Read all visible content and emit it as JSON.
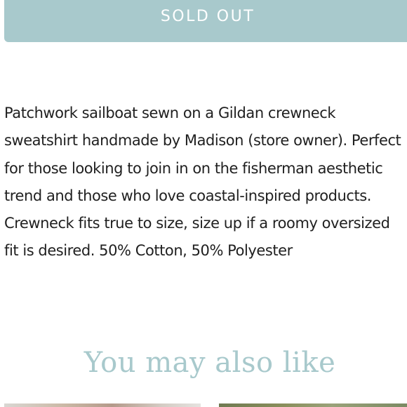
{
  "product": {
    "sold_out_label": "SOLD OUT",
    "description": "Patchwork sailboat sewn on a Gildan crewneck sweatshirt handmade by Madison (store owner). Perfect for those looking to join in on the fisherman aesthetic trend and those who love coastal-inspired products. Crewneck fits true to size, size up if a roomy oversized fit is desired. 50% Cotton, 50% Polyester"
  },
  "recommendations": {
    "title": "You may also like"
  },
  "colors": {
    "accent": "#a8c9cc",
    "text": "#1f1f1f",
    "background": "#ffffff"
  }
}
